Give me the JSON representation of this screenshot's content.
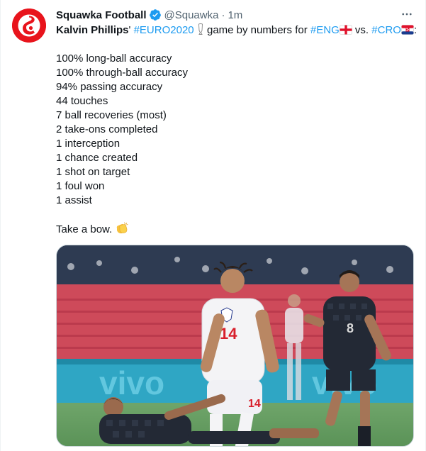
{
  "tweet": {
    "author_name": "Squawka Football",
    "handle": "@Squawka",
    "separator": "·",
    "time": "1m",
    "more_icon": "more-horizontal-icon",
    "verified_icon": "verified-badge-icon",
    "line1": {
      "name": "Kalvin Phillips",
      "apostrophe": "'",
      "tag_euro": "#EURO2020",
      "mid": " game by numbers for ",
      "tag_eng": "#ENG",
      "vs": " vs. ",
      "tag_cro": "#CRO",
      "end": ":"
    },
    "stats": [
      "100% long-ball accuracy",
      "100% through-ball accuracy",
      "94% passing accuracy",
      "44 touches",
      "7 ball recoveries (most)",
      "2 take-ons completed",
      "1 interception",
      "1 chance created",
      "1 shot on target",
      "1 foul won",
      "1 assist"
    ],
    "closing": "Take a bow.",
    "closing_emoji": "clapping-hands-emoji",
    "media": {
      "kind": "photo",
      "subject": "football match photo"
    }
  },
  "colors": {
    "link": "#1d9bf0",
    "text": "#0f1419",
    "secondary": "#536471",
    "verified": "#1d9bf0",
    "avatar_bg": "#e8141c"
  }
}
